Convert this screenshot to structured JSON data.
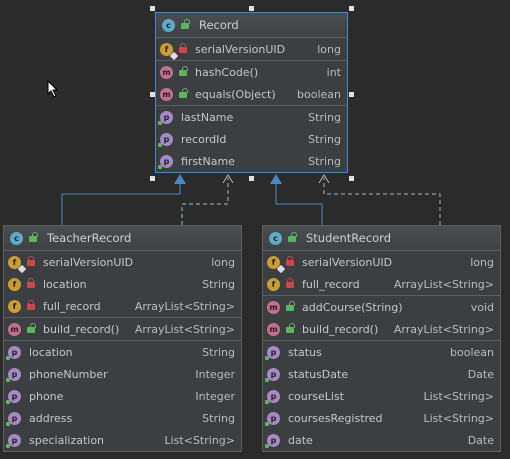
{
  "classes": [
    {
      "name": "Record",
      "sections": [
        [
          {
            "badge": "f",
            "vis": "lock",
            "name": "serialVersionUID",
            "type": "long",
            "pin": true
          }
        ],
        [
          {
            "badge": "m",
            "vis": "open",
            "name": "hashCode()",
            "type": "int"
          },
          {
            "badge": "m",
            "vis": "open",
            "name": "equals(Object)",
            "type": "boolean"
          }
        ],
        [
          {
            "badge": "p",
            "name": "lastName",
            "type": "String"
          },
          {
            "badge": "p",
            "name": "recordId",
            "type": "String"
          },
          {
            "badge": "p",
            "name": "firstName",
            "type": "String"
          }
        ]
      ]
    },
    {
      "name": "TeacherRecord",
      "sections": [
        [
          {
            "badge": "f",
            "vis": "lock",
            "name": "serialVersionUID",
            "type": "long",
            "pin": true
          },
          {
            "badge": "f",
            "vis": "lock",
            "name": "location",
            "type": "String"
          },
          {
            "badge": "f",
            "vis": "lock",
            "name": "full_record",
            "type": "ArrayList<String>"
          }
        ],
        [
          {
            "badge": "m",
            "vis": "open",
            "name": "build_record()",
            "type": "ArrayList<String>"
          }
        ],
        [
          {
            "badge": "p",
            "name": "location",
            "type": "String"
          },
          {
            "badge": "p",
            "name": "phoneNumber",
            "type": "Integer"
          },
          {
            "badge": "p",
            "name": "phone",
            "type": "Integer"
          },
          {
            "badge": "p",
            "name": "address",
            "type": "String"
          },
          {
            "badge": "p",
            "name": "specialization",
            "type": "List<String>"
          }
        ]
      ]
    },
    {
      "name": "StudentRecord",
      "sections": [
        [
          {
            "badge": "f",
            "vis": "lock",
            "name": "serialVersionUID",
            "type": "long",
            "pin": true
          },
          {
            "badge": "f",
            "vis": "lock",
            "name": "full_record",
            "type": "ArrayList<String>"
          }
        ],
        [
          {
            "badge": "m",
            "vis": "open",
            "name": "addCourse(String)",
            "type": "void"
          },
          {
            "badge": "m",
            "vis": "open",
            "name": "build_record()",
            "type": "ArrayList<String>"
          }
        ],
        [
          {
            "badge": "p",
            "name": "status",
            "type": "boolean"
          },
          {
            "badge": "p",
            "name": "statusDate",
            "type": "Date"
          },
          {
            "badge": "p",
            "name": "courseList",
            "type": "List<String>"
          },
          {
            "badge": "p",
            "name": "coursesRegistred",
            "type": "List<String>"
          },
          {
            "badge": "p",
            "name": "date",
            "type": "Date"
          }
        ]
      ]
    }
  ],
  "colors": {
    "background": "#2b2b2b",
    "inheritance_edge": "#4a88c7",
    "implements_edge": "#a9b7c6",
    "selection": "#4a88c7"
  }
}
